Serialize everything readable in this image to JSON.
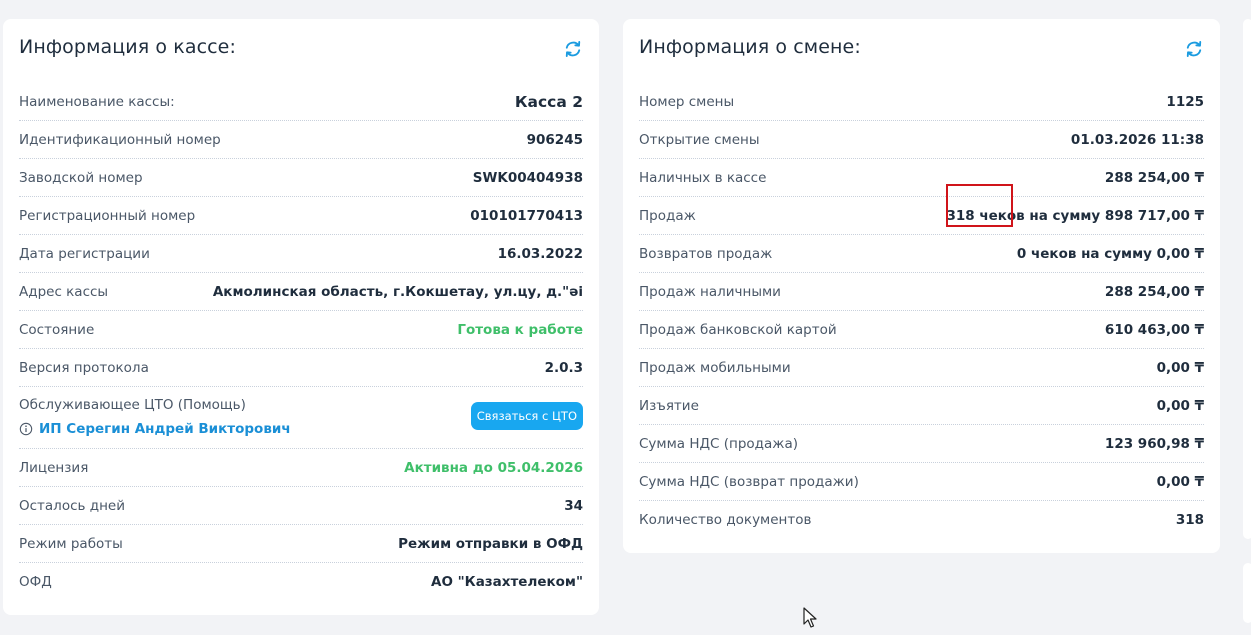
{
  "kassa": {
    "title": "Информация о кассе:",
    "rows": [
      {
        "label": "Наименование кассы:",
        "value": "Касса 2"
      },
      {
        "label": "Идентификационный номер",
        "value": "906245"
      },
      {
        "label": "Заводской номер",
        "value": "SWK00404938"
      },
      {
        "label": "Регистрационный номер",
        "value": "010101770413"
      },
      {
        "label": "Дата регистрации",
        "value": "16.03.2022"
      },
      {
        "label": "Адрес кассы",
        "value": "Акмолинская область, г.Кокшетау, ул.цу, д.\"әі"
      },
      {
        "label": "Состояние",
        "value": "Готова к работе"
      },
      {
        "label": "Версия протокола",
        "value": "2.0.3"
      },
      {
        "label": "Обслуживающее ЦТО (Помощь)",
        "link": "ИП Серегин Андрей Викторович",
        "button": "Связаться с ЦТО"
      },
      {
        "label": "Лицензия",
        "value": "Активна до 05.04.2026"
      },
      {
        "label": "Осталось дней",
        "value": "34"
      },
      {
        "label": "Режим работы",
        "value": "Режим отправки в ОФД"
      },
      {
        "label": "ОФД",
        "value": "АО \"Казахтелеком\""
      }
    ]
  },
  "smena": {
    "title": "Информация о смене:",
    "rows": [
      {
        "label": "Номер смены",
        "value": "1125"
      },
      {
        "label": "Открытие смены",
        "value": "01.03.2026 11:38"
      },
      {
        "label": "Наличных в кассе",
        "value": "288 254,00 ₸"
      },
      {
        "label": "Продаж",
        "value": "318 чеков на сумму 898 717,00 ₸"
      },
      {
        "label": "Возвратов продаж",
        "value": "0 чеков на сумму 0,00 ₸"
      },
      {
        "label": "Продаж наличными",
        "value": "288 254,00 ₸"
      },
      {
        "label": "Продаж банковской картой",
        "value": "610 463,00 ₸"
      },
      {
        "label": "Продаж мобильными",
        "value": "0,00 ₸"
      },
      {
        "label": "Изъятие",
        "value": "0,00 ₸"
      },
      {
        "label": "Сумма НДС (продажа)",
        "value": "123 960,98 ₸"
      },
      {
        "label": "Сумма НДС (возврат продажи)",
        "value": "0,00 ₸"
      },
      {
        "label": "Количество документов",
        "value": "318"
      }
    ]
  },
  "colors": {
    "background": "#f2f3f6",
    "card": "#ffffff",
    "text": "#1f2d3d",
    "label": "#4a5767",
    "accent": "#18a7f0",
    "link": "#1a8fd6",
    "success": "#3fbf6a",
    "highlight": "#d0141a"
  },
  "icons": {
    "refresh": "refresh-icon",
    "info": "info-icon",
    "cursor": "mouse-pointer-icon"
  }
}
